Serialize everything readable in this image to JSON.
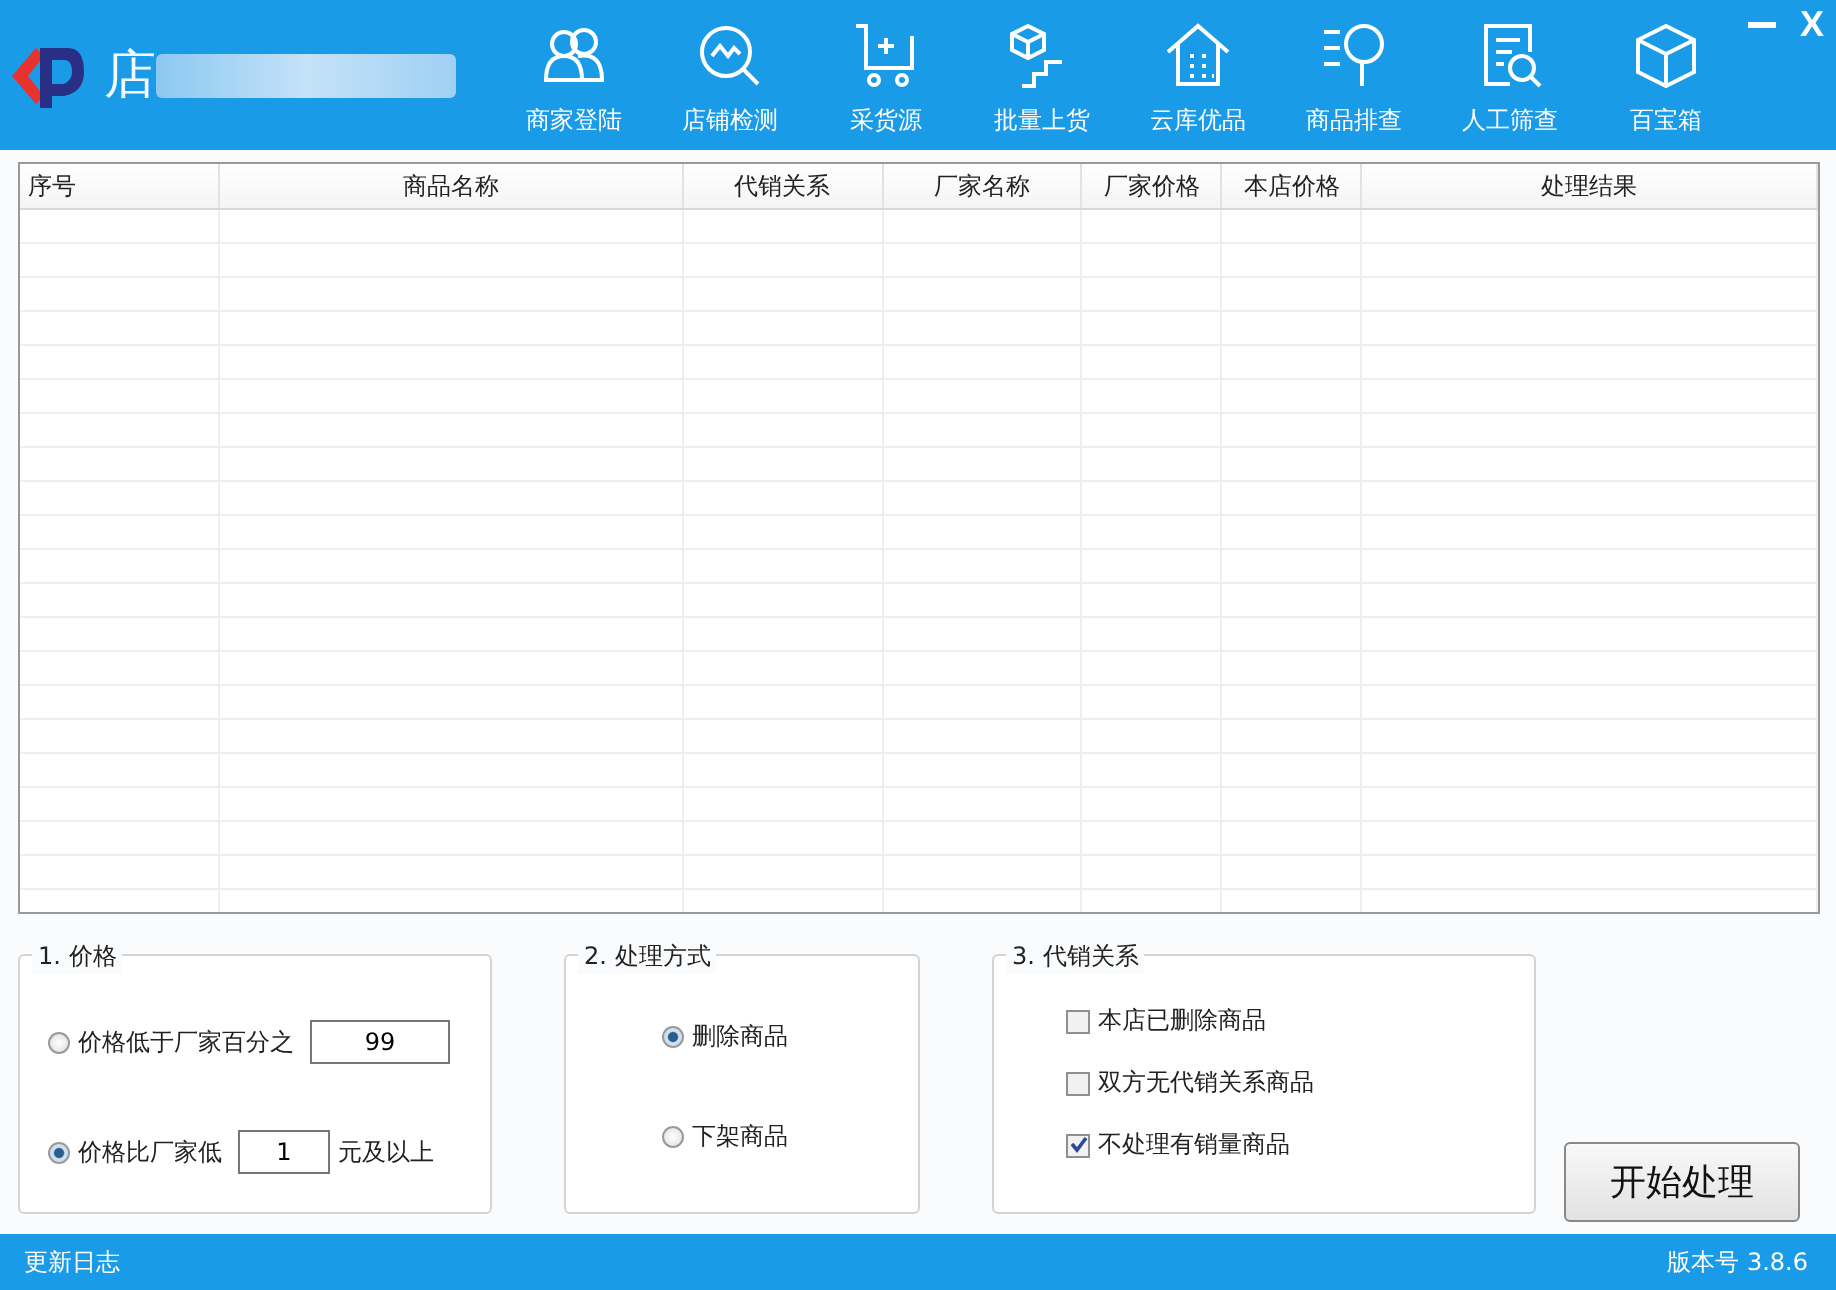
{
  "app": {
    "title": "店"
  },
  "nav": [
    {
      "label": "商家登陆",
      "kind": "people"
    },
    {
      "label": "店铺检测",
      "kind": "scan"
    },
    {
      "label": "采货源",
      "kind": "cart"
    },
    {
      "label": "批量上货",
      "kind": "stairs"
    },
    {
      "label": "云库优品",
      "kind": "house"
    },
    {
      "label": "商品排查",
      "kind": "find"
    },
    {
      "label": "人工筛查",
      "kind": "doc"
    },
    {
      "label": "百宝箱",
      "kind": "box"
    }
  ],
  "window_controls": {
    "close": "X"
  },
  "table": {
    "columns": [
      "序号",
      "商品名称",
      "代销关系",
      "厂家名称",
      "厂家价格",
      "本店价格",
      "处理结果"
    ]
  },
  "price_group": {
    "title": "1. 价格",
    "options": [
      {
        "label": "价格低于厂家百分之",
        "selected": false,
        "value": "99"
      },
      {
        "label": "价格比厂家低",
        "selected": true,
        "value": "1",
        "suffix": "元及以上"
      }
    ]
  },
  "method_group": {
    "title": "2. 处理方式",
    "options": [
      {
        "label": "删除商品",
        "selected": true
      },
      {
        "label": "下架商品",
        "selected": false
      }
    ]
  },
  "consign_group": {
    "title": "3. 代销关系",
    "options": [
      {
        "label": "本店已删除商品",
        "checked": false
      },
      {
        "label": "双方无代销关系商品",
        "checked": false
      },
      {
        "label": "不处理有销量商品",
        "checked": true
      }
    ]
  },
  "start_button": "开始处理",
  "status_bar": {
    "left": "更新日志",
    "right": "版本号 3.8.6"
  }
}
